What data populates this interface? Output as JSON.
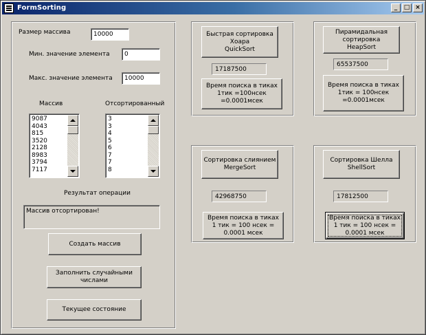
{
  "window": {
    "title": "FormSorting",
    "minimize_glyph": "_",
    "maximize_glyph": "□",
    "close_glyph": "×",
    "icon": "form-icon"
  },
  "left_panel": {
    "array_size_label": "Размер массива",
    "array_size_value": "10000",
    "min_label": "Мин. значение элемента",
    "min_value": "0",
    "max_label": "Макс. значение элемента",
    "max_value": "10000",
    "array_list_label": "Массив",
    "array_items": [
      "9087",
      "4043",
      "815",
      "3520",
      "2128",
      "8983",
      "3794",
      "7117"
    ],
    "sorted_list_label": "Отсортированный",
    "sorted_items": [
      "3",
      "3",
      "4",
      "5",
      "6",
      "7",
      "7",
      "8"
    ],
    "result_label": "Результат операции",
    "result_text": "Массив отсортирован!",
    "create_button": "Создать массив",
    "fill_button": "Заполнить случайными\nчислами",
    "state_button": "Текущее состояние"
  },
  "sorts": {
    "quick": {
      "sort_button": "Быстрая сортировка\nХоара\nQuickSort",
      "ticks": "17187500",
      "time_button": "Время поиска в тиках\n1тик =100нсек\n=0.0001мсек"
    },
    "heap": {
      "sort_button": "Пирамидальная\nсортировка\nHeapSort",
      "ticks": "65537500",
      "time_button": "Время поиска в тиках\n1тик = 100нсек\n=0.0001мсек"
    },
    "merge": {
      "sort_button": "Сортировка слиянием\nMergeSort",
      "ticks": "42968750",
      "time_button": "Время поиска в тиках\n1 тик = 100 нсек =\n0.0001 мсек"
    },
    "shell": {
      "sort_button": "Сортировка Шелла\nShellSort",
      "ticks": "17812500",
      "time_button": "Время поиска в тиках\n1 тик = 100 нсек =\n0.0001 мсек"
    }
  }
}
